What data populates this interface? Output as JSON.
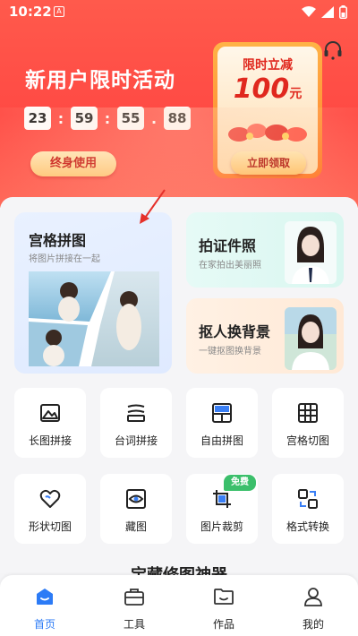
{
  "status_bar": {
    "time": "10:22",
    "a_indicator": "A"
  },
  "banner": {
    "title": "新用户限时活动",
    "countdown": [
      "23",
      "59",
      "55",
      "88"
    ],
    "separators": [
      ":",
      ":",
      "."
    ],
    "lifetime_button": "终身使用",
    "promo_card": {
      "label": "限时立减",
      "amount": "100",
      "unit": "元",
      "claim_button": "立即领取"
    },
    "colors": {
      "banner_red": "#ff4a44",
      "promo_orange": "#ff7a2a",
      "promo_text": "#e0281e"
    }
  },
  "features": {
    "grid_collage": {
      "title": "宫格拼图",
      "subtitle": "将图片拼接在一起"
    },
    "id_photo": {
      "title": "拍证件照",
      "subtitle": "在家拍出美丽照"
    },
    "cutout": {
      "title": "抠人换背景",
      "subtitle": "一键抠图换背景"
    }
  },
  "tools": [
    {
      "label": "长图拼接",
      "icon": "long-image-icon"
    },
    {
      "label": "台词拼接",
      "icon": "subtitle-stack-icon"
    },
    {
      "label": "自由拼图",
      "icon": "free-collage-icon"
    },
    {
      "label": "宫格切图",
      "icon": "grid-cut-icon"
    },
    {
      "label": "形状切图",
      "icon": "heart-shape-icon"
    },
    {
      "label": "藏图",
      "icon": "hidden-image-icon"
    },
    {
      "label": "图片裁剪",
      "icon": "crop-icon",
      "badge": "免费"
    },
    {
      "label": "格式转换",
      "icon": "format-convert-icon"
    }
  ],
  "section_peek": "宝藏修图神器",
  "nav": [
    {
      "label": "首页",
      "icon": "home-icon",
      "active": true
    },
    {
      "label": "工具",
      "icon": "toolbox-icon",
      "active": false
    },
    {
      "label": "作品",
      "icon": "folder-icon",
      "active": false
    },
    {
      "label": "我的",
      "icon": "profile-icon",
      "active": false
    }
  ],
  "accent_color": "#2c7bf6"
}
